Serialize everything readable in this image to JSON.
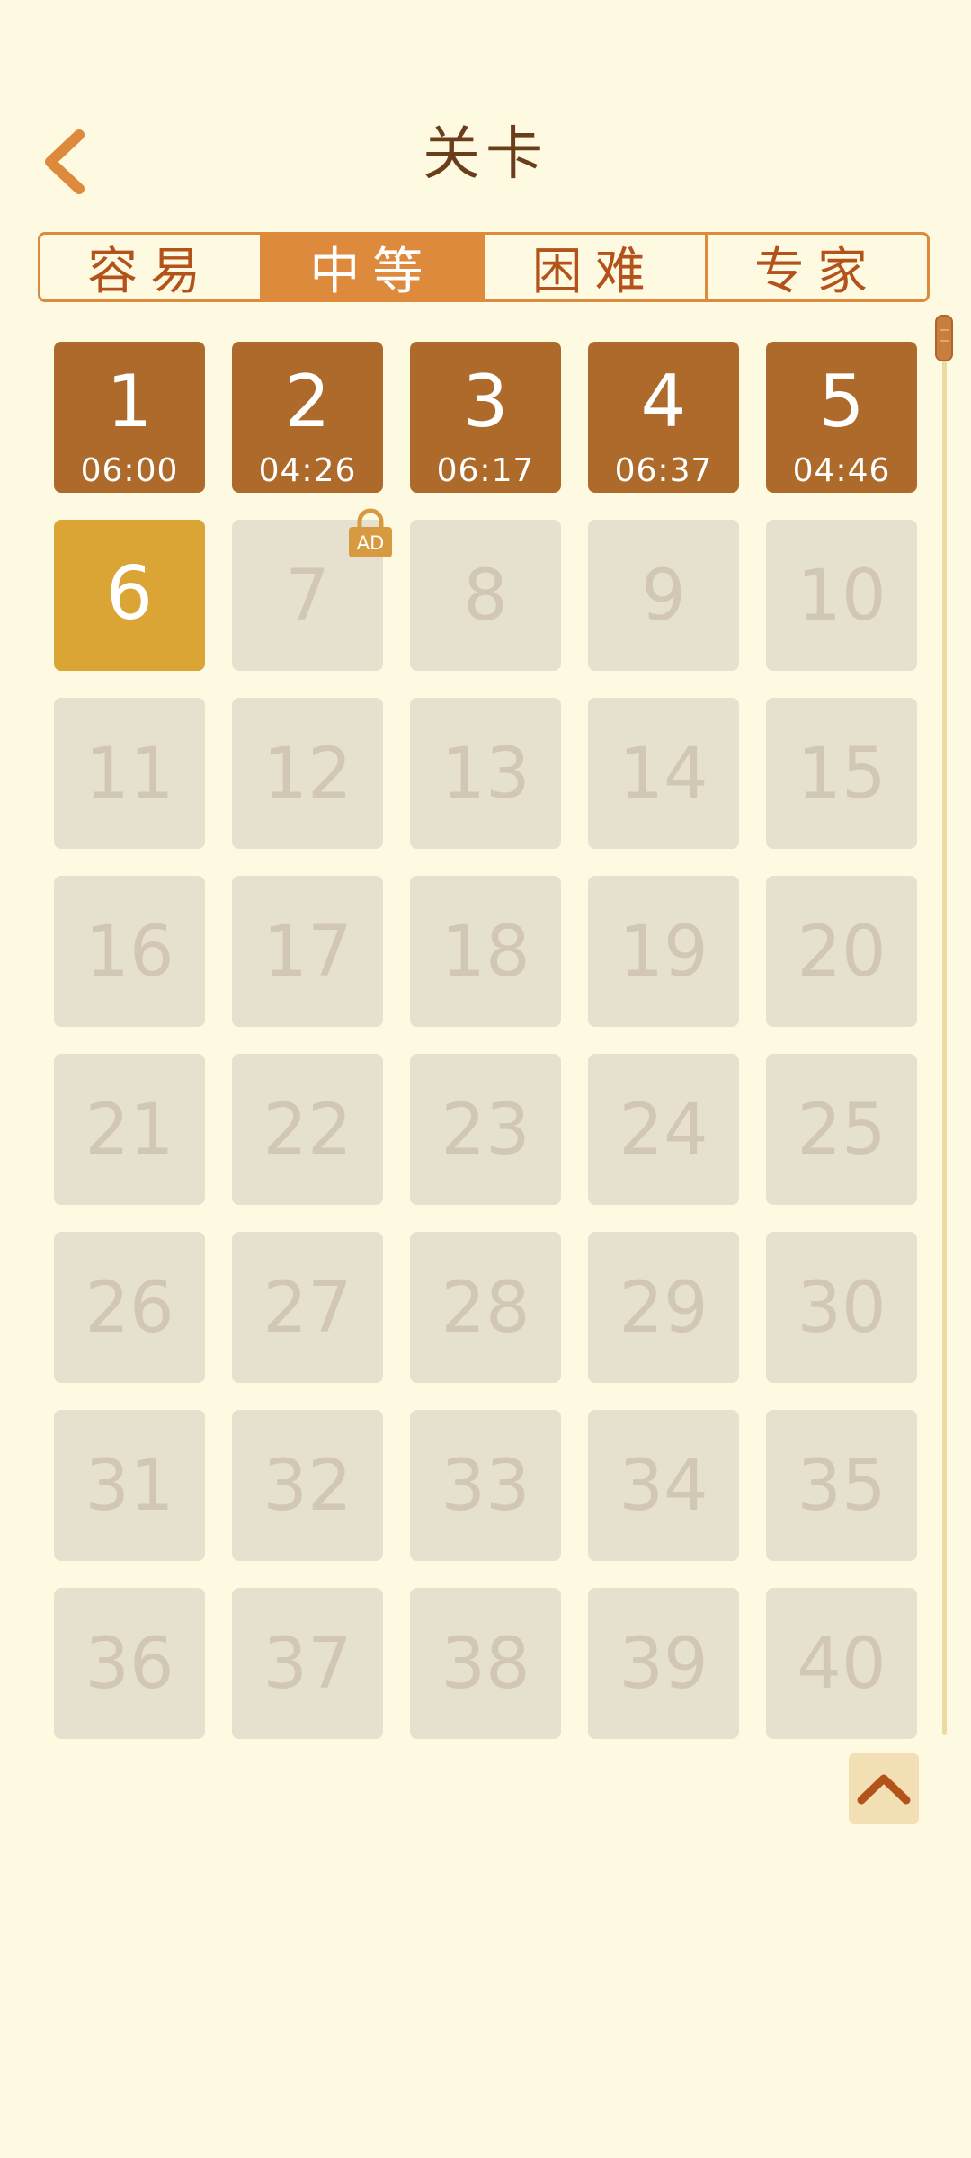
{
  "header": {
    "title": "关卡"
  },
  "tabs": [
    {
      "label": "容易",
      "active": false
    },
    {
      "label": "中等",
      "active": true
    },
    {
      "label": "困难",
      "active": false
    },
    {
      "label": "专家",
      "active": false
    }
  ],
  "levels": [
    {
      "num": "1",
      "state": "done",
      "time": "06:00"
    },
    {
      "num": "2",
      "state": "done",
      "time": "04:26"
    },
    {
      "num": "3",
      "state": "done",
      "time": "06:17"
    },
    {
      "num": "4",
      "state": "done",
      "time": "06:37"
    },
    {
      "num": "5",
      "state": "done",
      "time": "04:46"
    },
    {
      "num": "6",
      "state": "current"
    },
    {
      "num": "7",
      "state": "locked",
      "ad": true
    },
    {
      "num": "8",
      "state": "locked"
    },
    {
      "num": "9",
      "state": "locked"
    },
    {
      "num": "10",
      "state": "locked"
    },
    {
      "num": "11",
      "state": "locked"
    },
    {
      "num": "12",
      "state": "locked"
    },
    {
      "num": "13",
      "state": "locked"
    },
    {
      "num": "14",
      "state": "locked"
    },
    {
      "num": "15",
      "state": "locked"
    },
    {
      "num": "16",
      "state": "locked"
    },
    {
      "num": "17",
      "state": "locked"
    },
    {
      "num": "18",
      "state": "locked"
    },
    {
      "num": "19",
      "state": "locked"
    },
    {
      "num": "20",
      "state": "locked"
    },
    {
      "num": "21",
      "state": "locked"
    },
    {
      "num": "22",
      "state": "locked"
    },
    {
      "num": "23",
      "state": "locked"
    },
    {
      "num": "24",
      "state": "locked"
    },
    {
      "num": "25",
      "state": "locked"
    },
    {
      "num": "26",
      "state": "locked"
    },
    {
      "num": "27",
      "state": "locked"
    },
    {
      "num": "28",
      "state": "locked"
    },
    {
      "num": "29",
      "state": "locked"
    },
    {
      "num": "30",
      "state": "locked"
    },
    {
      "num": "31",
      "state": "locked"
    },
    {
      "num": "32",
      "state": "locked"
    },
    {
      "num": "33",
      "state": "locked"
    },
    {
      "num": "34",
      "state": "locked"
    },
    {
      "num": "35",
      "state": "locked"
    },
    {
      "num": "36",
      "state": "locked"
    },
    {
      "num": "37",
      "state": "locked"
    },
    {
      "num": "38",
      "state": "locked"
    },
    {
      "num": "39",
      "state": "locked"
    },
    {
      "num": "40",
      "state": "locked"
    }
  ],
  "ad_badge": {
    "label": "AD"
  },
  "icons": {
    "back": "chevron-left-icon",
    "lock": "lock-icon",
    "scroll_top": "chevron-up-icon"
  },
  "colors": {
    "background": "#FEF9E1",
    "accent": "#DE8A3D",
    "done_tile": "#AD6A2A",
    "current_tile": "#DBA535",
    "locked_tile": "#E6E1CF",
    "locked_text": "#D1C7B4"
  }
}
